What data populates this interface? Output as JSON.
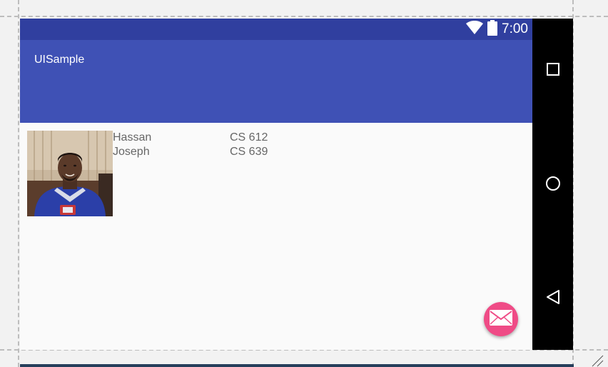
{
  "status_bar": {
    "time": "7:00",
    "wifi_icon": "wifi-icon",
    "battery_icon": "battery-icon",
    "background": "#303f9f"
  },
  "app_bar": {
    "title": "UISample",
    "background": "#3f51b5"
  },
  "list": {
    "items": [
      {
        "names": [
          "Hassan",
          "Joseph"
        ],
        "courses": [
          "CS 612",
          "CS 639"
        ]
      }
    ]
  },
  "fab": {
    "icon": "mail-icon",
    "color": "#ef4b86"
  },
  "nav_bar": {
    "buttons": [
      {
        "icon": "recent-apps-icon"
      },
      {
        "icon": "home-icon"
      },
      {
        "icon": "back-icon"
      }
    ]
  }
}
